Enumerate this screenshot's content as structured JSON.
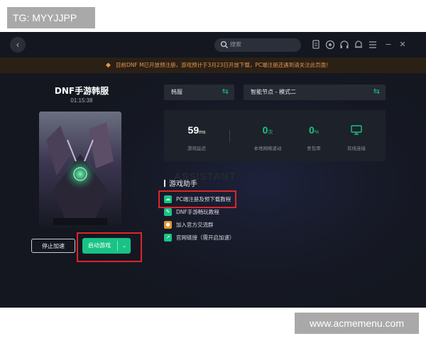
{
  "watermarks": {
    "top_left": "TG: MYYJJPP",
    "bottom_right": "www.acmemenu.com"
  },
  "titlebar": {
    "search_placeholder": "搜索",
    "icons": [
      "clipboard-icon",
      "speedometer-icon",
      "headset-icon",
      "bell-icon",
      "menu-icon",
      "minimize-icon",
      "close-icon"
    ],
    "minimize_glyph": "−",
    "close_glyph": "✕"
  },
  "notice": {
    "text": "目前DNF M已开放预注册，游戏预计于3月23日开放下载，PC端注册还遇到请关注此页面！"
  },
  "game": {
    "title": "DNF手游韩服",
    "timer": "01:15:38"
  },
  "buttons": {
    "stop": "停止加速",
    "start": "启动游戏",
    "start_dropdown": "⌄"
  },
  "region_selector": {
    "label": "韩服",
    "swap": "⇆"
  },
  "node_selector": {
    "label": "智能节点 - 模式二",
    "swap": "⇆"
  },
  "stats": [
    {
      "value": "59",
      "unit": "ms",
      "label": "游戏延迟"
    },
    {
      "value": "0",
      "unit": "次",
      "label": "本地网络波动"
    },
    {
      "value": "0",
      "unit": "%",
      "label": "丢包率"
    },
    {
      "value": "",
      "unit": "",
      "label": "有线连接"
    }
  ],
  "assistant": {
    "bg_text": "ASSISTANT",
    "title": "游戏助手",
    "items": [
      {
        "text": "PC端注册及预下载教程",
        "icon": "download-cloud-icon",
        "color": "#19c386"
      },
      {
        "text": "DNF手游畅玩教程",
        "icon": "guide-icon",
        "color": "#19c386"
      },
      {
        "text": "加入官方交流群",
        "icon": "group-icon",
        "color": "#e0962f"
      },
      {
        "text": "官网链接（需开启加速）",
        "icon": "link-icon",
        "color": "#19c386"
      }
    ]
  },
  "colors": {
    "accent": "#19c386",
    "highlight": "#e0242a",
    "notice": "#e0964a"
  }
}
